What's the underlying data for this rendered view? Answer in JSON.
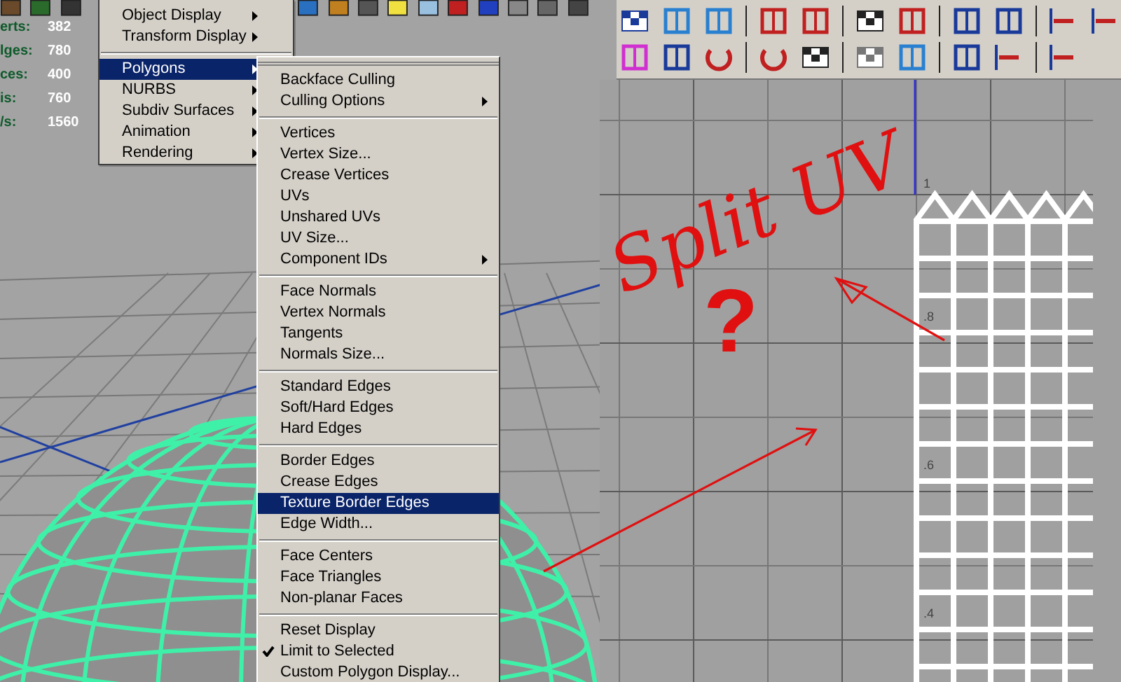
{
  "viewport_stats": [
    {
      "label": "erts:",
      "value": "382"
    },
    {
      "label": "lges:",
      "value": "780"
    },
    {
      "label": "ces:",
      "value": "400"
    },
    {
      "label": "is:",
      "value": "760"
    },
    {
      "label": "/s:",
      "value": "1560"
    }
  ],
  "display_menu": {
    "items": [
      {
        "label": "Object Display",
        "submenu": true,
        "selected": false,
        "separator_before": false
      },
      {
        "label": "Transform Display",
        "submenu": true,
        "selected": false,
        "separator_before": false
      },
      {
        "label": "Polygons",
        "submenu": true,
        "selected": true,
        "separator_before": true
      },
      {
        "label": "NURBS",
        "submenu": true,
        "selected": false,
        "separator_before": false
      },
      {
        "label": "Subdiv Surfaces",
        "submenu": true,
        "selected": false,
        "separator_before": false
      },
      {
        "label": "Animation",
        "submenu": true,
        "selected": false,
        "separator_before": false
      },
      {
        "label": "Rendering",
        "submenu": true,
        "selected": false,
        "separator_before": false
      }
    ]
  },
  "polygons_submenu": {
    "groups": [
      {
        "items": [
          {
            "label": "Backface Culling",
            "submenu": false,
            "selected": false,
            "checked": false
          },
          {
            "label": "Culling Options",
            "submenu": true,
            "selected": false,
            "checked": false
          }
        ]
      },
      {
        "items": [
          {
            "label": "Vertices",
            "submenu": false,
            "selected": false,
            "checked": false
          },
          {
            "label": "Vertex Size...",
            "submenu": false,
            "selected": false,
            "checked": false
          },
          {
            "label": "Crease Vertices",
            "submenu": false,
            "selected": false,
            "checked": false
          },
          {
            "label": "UVs",
            "submenu": false,
            "selected": false,
            "checked": false
          },
          {
            "label": "Unshared UVs",
            "submenu": false,
            "selected": false,
            "checked": false
          },
          {
            "label": "UV Size...",
            "submenu": false,
            "selected": false,
            "checked": false
          },
          {
            "label": "Component IDs",
            "submenu": true,
            "selected": false,
            "checked": false
          }
        ]
      },
      {
        "items": [
          {
            "label": "Face Normals",
            "submenu": false,
            "selected": false,
            "checked": false
          },
          {
            "label": "Vertex Normals",
            "submenu": false,
            "selected": false,
            "checked": false
          },
          {
            "label": "Tangents",
            "submenu": false,
            "selected": false,
            "checked": false
          },
          {
            "label": "Normals Size...",
            "submenu": false,
            "selected": false,
            "checked": false
          }
        ]
      },
      {
        "items": [
          {
            "label": "Standard Edges",
            "submenu": false,
            "selected": false,
            "checked": false
          },
          {
            "label": "Soft/Hard Edges",
            "submenu": false,
            "selected": false,
            "checked": false
          },
          {
            "label": "Hard Edges",
            "submenu": false,
            "selected": false,
            "checked": false
          }
        ]
      },
      {
        "items": [
          {
            "label": "Border Edges",
            "submenu": false,
            "selected": false,
            "checked": false
          },
          {
            "label": "Crease Edges",
            "submenu": false,
            "selected": false,
            "checked": false
          },
          {
            "label": "Texture Border Edges",
            "submenu": false,
            "selected": true,
            "checked": false
          },
          {
            "label": "Edge Width...",
            "submenu": false,
            "selected": false,
            "checked": false
          }
        ]
      },
      {
        "items": [
          {
            "label": "Face Centers",
            "submenu": false,
            "selected": false,
            "checked": false
          },
          {
            "label": "Face Triangles",
            "submenu": false,
            "selected": false,
            "checked": false
          },
          {
            "label": "Non-planar Faces",
            "submenu": false,
            "selected": false,
            "checked": false
          }
        ]
      },
      {
        "items": [
          {
            "label": "Reset Display",
            "submenu": false,
            "selected": false,
            "checked": false
          },
          {
            "label": "Limit to Selected",
            "submenu": false,
            "selected": false,
            "checked": true
          },
          {
            "label": "Custom Polygon Display...",
            "submenu": false,
            "selected": false,
            "checked": false
          }
        ]
      }
    ]
  },
  "uv_axis_labels": [
    "1",
    ".8",
    ".6",
    ".4"
  ],
  "annotations": [
    {
      "kind": "title",
      "text": "Split UV"
    },
    {
      "kind": "question",
      "text": "?"
    }
  ]
}
